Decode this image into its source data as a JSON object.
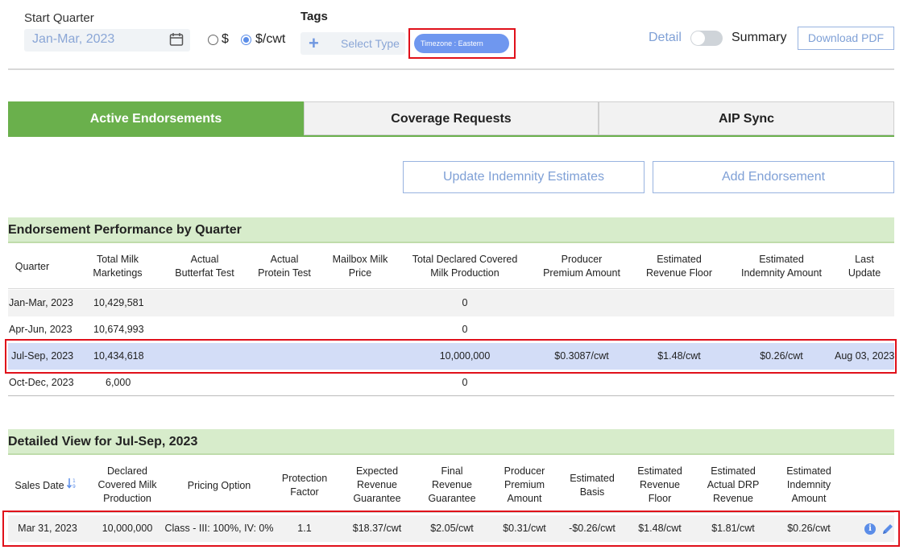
{
  "filters": {
    "start_quarter_label": "Start Quarter",
    "start_quarter_value": "Jan-Mar, 2023",
    "unit_options": [
      "$",
      "$/cwt"
    ],
    "unit_selected": "$/cwt",
    "tags_label": "Tags",
    "select_type_placeholder": "Select Type",
    "timezone_tag": "Timezone : Eastern",
    "detail_label": "Detail",
    "summary_label": "Summary",
    "download_pdf": "Download PDF",
    "toggle_state": "Detail"
  },
  "tabs": [
    {
      "label": "Active Endorsements",
      "active": true
    },
    {
      "label": "Coverage Requests",
      "active": false
    },
    {
      "label": "AIP Sync",
      "active": false
    }
  ],
  "actions": {
    "update_indemnity": "Update Indemnity Estimates",
    "add_endorsement": "Add Endorsement"
  },
  "performance": {
    "title": "Endorsement Performance by Quarter",
    "columns": [
      [
        "Quarter"
      ],
      [
        "Total Milk",
        "Marketings"
      ],
      [
        "Actual",
        "Butterfat Test"
      ],
      [
        "Actual",
        "Protein Test"
      ],
      [
        "Mailbox Milk",
        "Price"
      ],
      [
        "Total Declared Covered",
        "Milk Production"
      ],
      [
        "Producer",
        "Premium Amount"
      ],
      [
        "Estimated",
        "Revenue Floor"
      ],
      [
        "Estimated",
        "Indemnity Amount"
      ],
      [
        "Last",
        "Update"
      ]
    ],
    "rows": [
      {
        "quarter": "Jan-Mar, 2023",
        "marketings": "10,429,581",
        "declared": "0",
        "premium": "",
        "floor": "",
        "indemnity": "",
        "updated": ""
      },
      {
        "quarter": "Apr-Jun, 2023",
        "marketings": "10,674,993",
        "declared": "0",
        "premium": "",
        "floor": "",
        "indemnity": "",
        "updated": ""
      },
      {
        "quarter": "Jul-Sep, 2023",
        "marketings": "10,434,618",
        "declared": "10,000,000",
        "premium": "$0.3087/cwt",
        "floor": "$1.48/cwt",
        "indemnity": "$0.26/cwt",
        "updated": "Aug 03, 2023"
      },
      {
        "quarter": "Oct-Dec, 2023",
        "marketings": "6,000",
        "declared": "0",
        "premium": "",
        "floor": "",
        "indemnity": "",
        "updated": ""
      }
    ]
  },
  "detail": {
    "title": "Detailed View for Jul-Sep, 2023",
    "columns": [
      [
        "Sales Date"
      ],
      [
        "Declared",
        "Covered Milk",
        "Production"
      ],
      [
        "Pricing Option"
      ],
      [
        "Protection",
        "Factor"
      ],
      [
        "Expected",
        "Revenue",
        "Guarantee"
      ],
      [
        "Final",
        "Revenue",
        "Guarantee"
      ],
      [
        "Producer",
        "Premium",
        "Amount"
      ],
      [
        "Estimated",
        "Basis"
      ],
      [
        "Estimated",
        "Revenue",
        "Floor"
      ],
      [
        "Estimated",
        "Actual DRP",
        "Revenue"
      ],
      [
        "Estimated",
        "Indemnity",
        "Amount"
      ]
    ],
    "rows": [
      {
        "sales_date": "Mar 31, 2023",
        "declared": "10,000,000",
        "pricing": "Class - III: 100%, IV: 0%",
        "factor": "1.1",
        "expected": "$18.37/cwt",
        "final": "$2.05/cwt",
        "premium": "$0.31/cwt",
        "basis": "-$0.26/cwt",
        "floor": "$1.48/cwt",
        "actual": "$1.81/cwt",
        "indemnity": "$0.26/cwt"
      }
    ]
  },
  "icons": {
    "calendar": "calendar-icon",
    "plus": "plus-icon",
    "sort": "sort-icon",
    "info": "info-icon",
    "edit": "edit-icon"
  },
  "colors": {
    "accent_green": "#6ab04c",
    "section_green": "#d7eccb",
    "link_blue": "#7fa0d6",
    "highlight_red": "#e0101a",
    "selected_row": "#d3ddf7"
  }
}
